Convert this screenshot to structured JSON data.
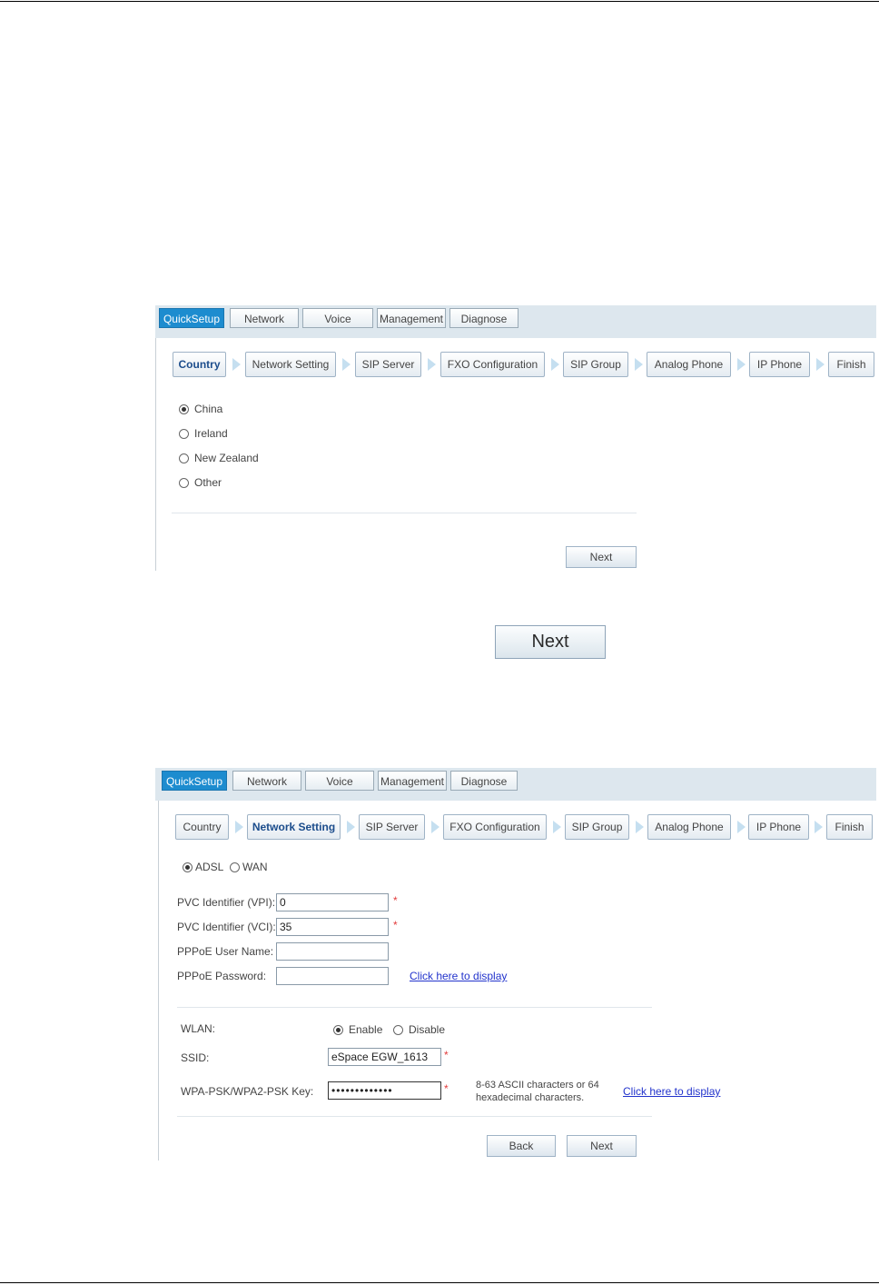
{
  "nav_tabs": [
    "QuickSetup",
    "Network",
    "Voice",
    "Management",
    "Diagnose"
  ],
  "wizard_steps": [
    "Country",
    "Network Setting",
    "SIP Server",
    "FXO Configuration",
    "SIP Group",
    "Analog Phone",
    "IP Phone",
    "Finish"
  ],
  "country_screen": {
    "options": [
      "China",
      "Ireland",
      "New Zealand",
      "Other"
    ],
    "selected": "China",
    "next_label": "Next"
  },
  "big_next_label": "Next",
  "network_screen": {
    "mode_options": [
      "ADSL",
      "WAN"
    ],
    "mode_selected": "ADSL",
    "vpi_label": "PVC Identifier (VPI):",
    "vpi_value": "0",
    "vci_label": "PVC Identifier (VCI):",
    "vci_value": "35",
    "pppoe_user_label": "PPPoE User Name:",
    "pppoe_user_value": "",
    "pppoe_pass_label": "PPPoE Password:",
    "pppoe_pass_value": "",
    "click_display_1": "Click here to display",
    "wlan_label": "WLAN:",
    "wlan_enable": "Enable",
    "wlan_disable": "Disable",
    "wlan_selected": "Enable",
    "ssid_label": "SSID:",
    "ssid_value": "eSpace EGW_1613",
    "wpa_label": "WPA-PSK/WPA2-PSK Key:",
    "wpa_value": "•••••••••••••",
    "wpa_hint_1": "8-63 ASCII characters or 64",
    "wpa_hint_2": "hexadecimal characters.",
    "click_display_2": "Click here to display",
    "back_label": "Back",
    "next_label": "Next",
    "required_mark": "*"
  },
  "colors": {
    "active_tab": "#1d8ccf",
    "topbar": "#dde7ee",
    "link": "#2233cc",
    "required": "#e23b3b"
  }
}
